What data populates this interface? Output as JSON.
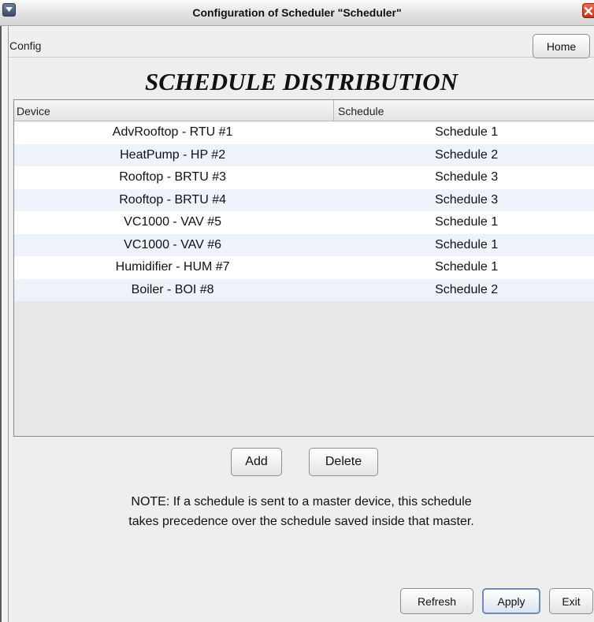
{
  "window": {
    "title": "Configuration of Scheduler \"Scheduler\""
  },
  "menubar": {
    "config_label": "Config",
    "home_label": "Home"
  },
  "main": {
    "heading": "SCHEDULE DISTRIBUTION",
    "table": {
      "columns": [
        "Device",
        "Schedule"
      ],
      "rows": [
        {
          "device": "AdvRooftop - RTU #1",
          "schedule": "Schedule 1"
        },
        {
          "device": "HeatPump - HP #2",
          "schedule": "Schedule 2"
        },
        {
          "device": "Rooftop - BRTU #3",
          "schedule": "Schedule 3"
        },
        {
          "device": "Rooftop - BRTU #4",
          "schedule": "Schedule 3"
        },
        {
          "device": "VC1000 - VAV #5",
          "schedule": "Schedule 1"
        },
        {
          "device": "VC1000 - VAV #6",
          "schedule": "Schedule 1"
        },
        {
          "device": "Humidifier - HUM #7",
          "schedule": "Schedule 1"
        },
        {
          "device": "Boiler - BOI #8",
          "schedule": "Schedule 2"
        }
      ]
    },
    "add_label": "Add",
    "delete_label": "Delete",
    "note_line1": "NOTE: If a schedule is sent to a master device, this schedule",
    "note_line2": "takes precedence over the schedule saved inside that master."
  },
  "footer": {
    "refresh_label": "Refresh",
    "apply_label": "Apply",
    "exit_label": "Exit"
  },
  "colors": {
    "row_alt": "#edf2fb",
    "close_button": "#d84a2e"
  },
  "icons": {
    "window_menu": "chevron-down-icon",
    "window_close": "close-icon"
  }
}
